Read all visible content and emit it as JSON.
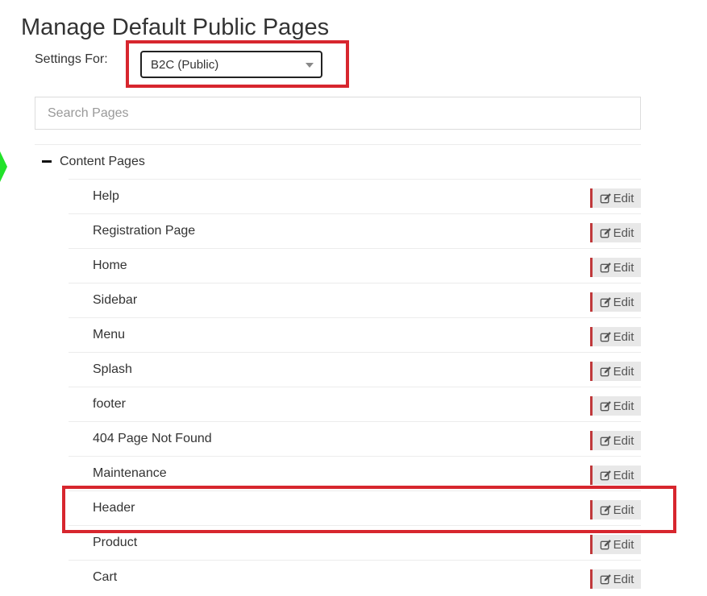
{
  "page": {
    "title": "Manage Default Public Pages"
  },
  "settings": {
    "label": "Settings For:",
    "selected": "B2C (Public)"
  },
  "search": {
    "placeholder": "Search Pages",
    "value": ""
  },
  "tree": {
    "section_label": "Content Pages",
    "edit_label": "Edit",
    "items": [
      {
        "name": "Help"
      },
      {
        "name": "Registration Page"
      },
      {
        "name": "Home"
      },
      {
        "name": "Sidebar"
      },
      {
        "name": "Menu"
      },
      {
        "name": "Splash"
      },
      {
        "name": "footer"
      },
      {
        "name": "404 Page Not Found"
      },
      {
        "name": "Maintenance"
      },
      {
        "name": "Header"
      },
      {
        "name": "Product"
      },
      {
        "name": "Cart"
      }
    ]
  },
  "colors": {
    "highlight": "#d7262e",
    "edit_accent": "#c0393b",
    "arrow": "#22e22a"
  }
}
